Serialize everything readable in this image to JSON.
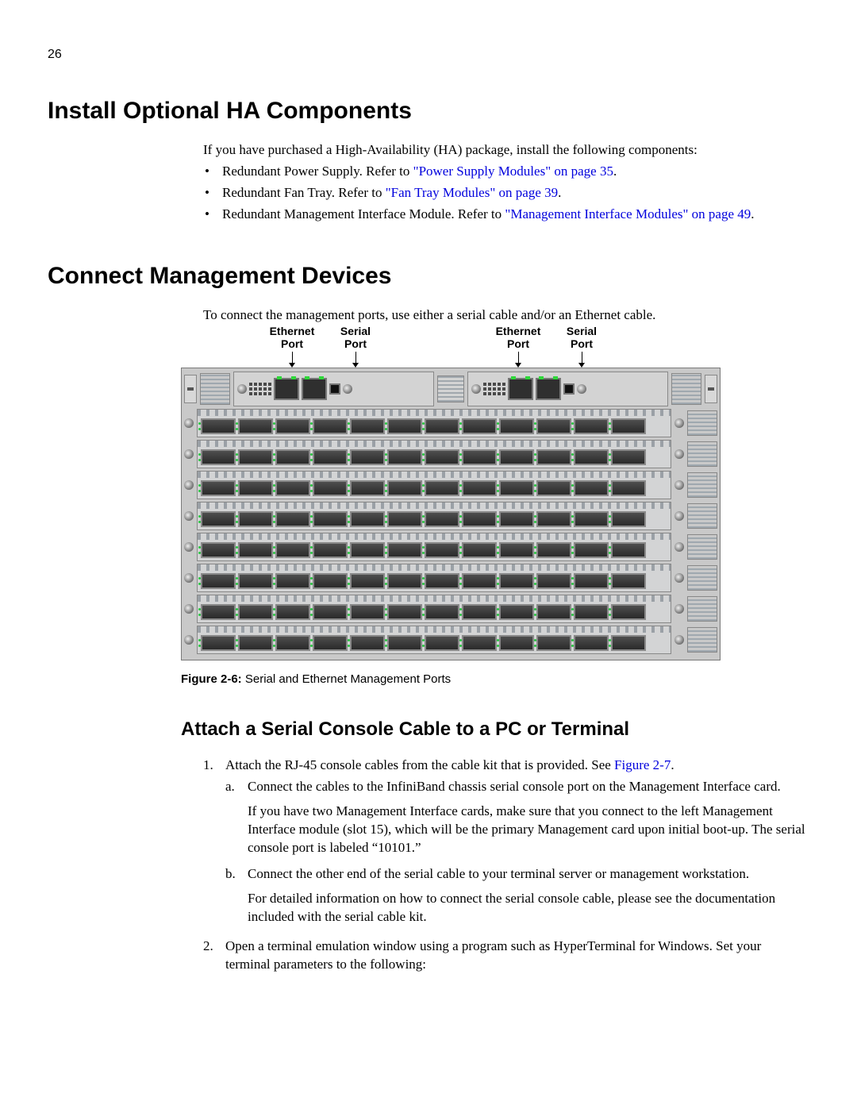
{
  "page_number": "26",
  "section1": {
    "title": "Install Optional HA Components",
    "intro": "If you have purchased a High-Availability (HA) package, install the following components:",
    "bullets": [
      {
        "lead": "Redundant Power Supply. Refer to ",
        "link": "\"Power Supply Modules\" on page 35",
        "tail": "."
      },
      {
        "lead": "Redundant Fan Tray. Refer to ",
        "link": "\"Fan Tray Modules\" on page 39",
        "tail": "."
      },
      {
        "lead": "Redundant Management Interface Module. Refer to ",
        "link": "\"Management Interface Modules\" on page 49",
        "tail": "."
      }
    ]
  },
  "section2": {
    "title": "Connect Management Devices",
    "intro": "To connect the management ports, use either a serial cable and/or an Ethernet cable.",
    "port_labels": {
      "ethernet": {
        "top": "Ethernet",
        "bottom": "Port"
      },
      "serial": {
        "top": "Serial",
        "bottom": "Port"
      }
    },
    "figure_caption": {
      "label": "Figure 2-6:",
      "text": " Serial and Ethernet Management Ports"
    }
  },
  "section3": {
    "title": "Attach a Serial Console Cable to a PC or Terminal",
    "steps": {
      "s1": {
        "text_lead": "Attach the RJ-45 console cables from the cable kit that is provided. See ",
        "link": "Figure 2-7",
        "text_tail": ".",
        "a_text": "Connect the cables to the InfiniBand chassis serial console port on the Management Interface card.",
        "a_para2": "If you have two Management Interface cards, make sure that you connect to the left Management Interface module (slot 15), which will be the primary Management card upon initial boot-up. The serial console port is labeled “10101.”",
        "b_text": "Connect the other end of the serial cable to your terminal server or management workstation.",
        "b_para2": "For detailed information on how to connect the serial console cable, please see the documentation included with the serial cable kit."
      },
      "s2": "Open a terminal emulation window using a program such as HyperTerminal for Windows. Set your terminal parameters to the following:"
    }
  }
}
